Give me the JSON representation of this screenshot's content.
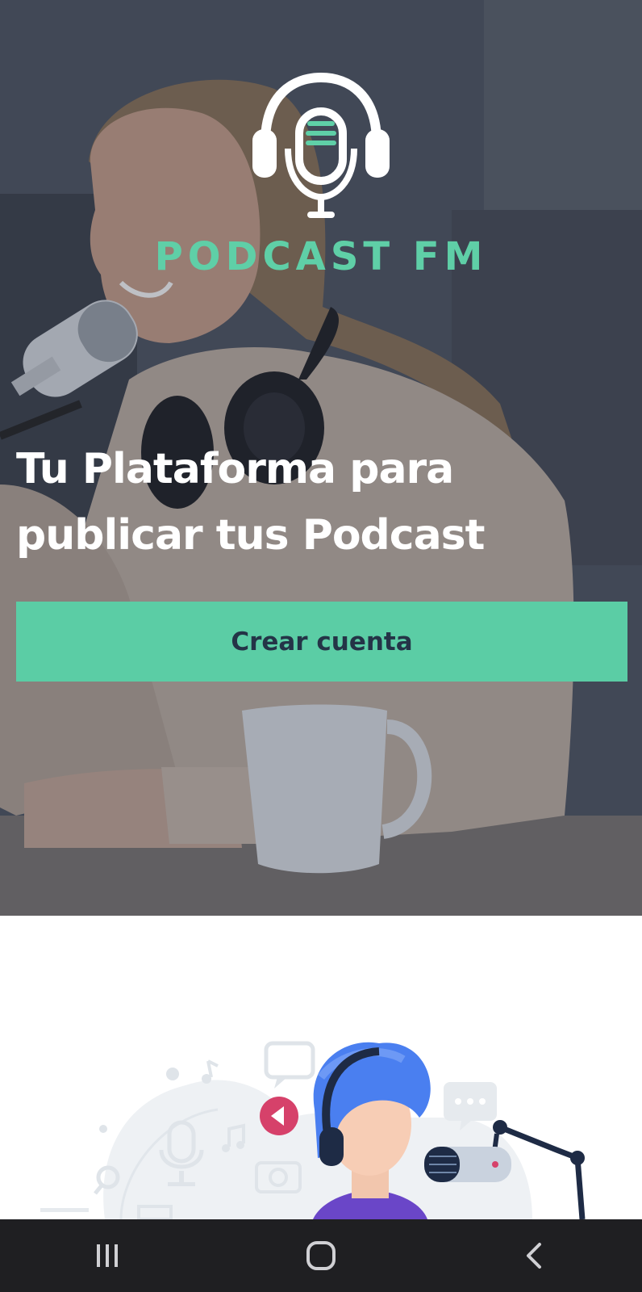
{
  "brand": {
    "name": "PODCAST FM"
  },
  "hero": {
    "tagline_line1": "Tu Plataforma para",
    "tagline_line2": "publicar tus Podcast",
    "cta_label": "Crear cuenta"
  },
  "colors": {
    "accent": "#5bcda5",
    "cta_text": "#243447",
    "nav_bar": "#1f1f22"
  },
  "icons": {
    "logo": "headphones-microphone-icon",
    "nav_recents": "recent-apps-icon",
    "nav_home": "home-icon",
    "nav_back": "back-icon"
  }
}
